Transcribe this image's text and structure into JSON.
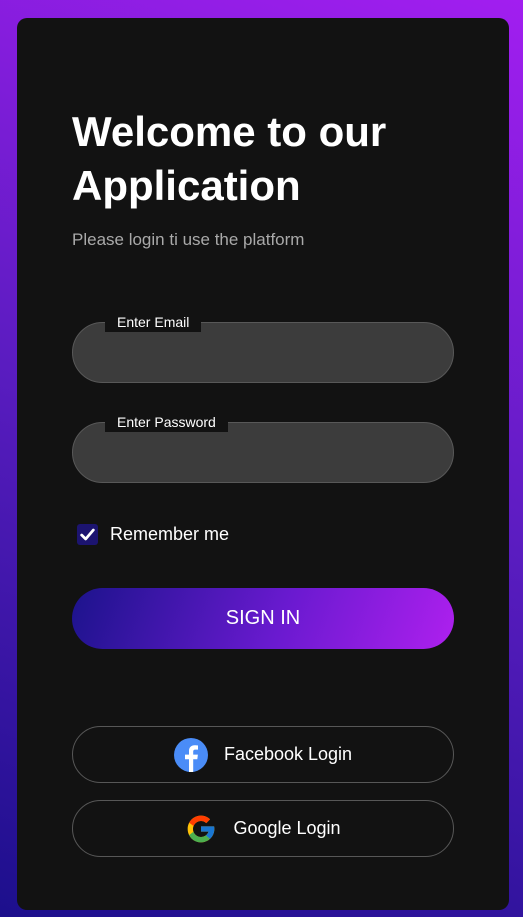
{
  "header": {
    "title": "Welcome to our Application",
    "subtitle": "Please login ti use the platform"
  },
  "form": {
    "email_label": "Enter Email",
    "email_value": "",
    "password_label": "Enter Password",
    "password_value": "",
    "remember_label": "Remember me",
    "remember_checked": true,
    "signin_label": "SIGN IN"
  },
  "social": {
    "facebook_label": "Facebook Login",
    "facebook_icon": "facebook-icon",
    "google_label": "Google Login",
    "google_icon": "google-icon"
  },
  "colors": {
    "background_start": "#1c0f8c",
    "background_end": "#a21ef0",
    "card": "#121212",
    "input": "#3c3c3c",
    "facebook": "#4a8cf7"
  }
}
